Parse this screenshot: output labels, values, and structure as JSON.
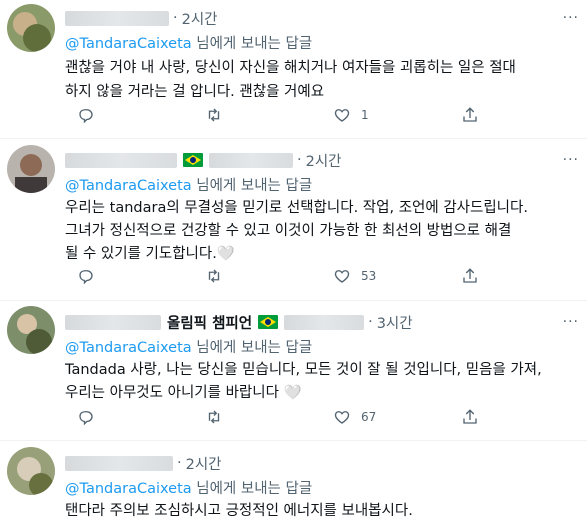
{
  "tweets": [
    {
      "time": "2시간",
      "mention": "@TandaraCaixeta",
      "reply_suffix": " 님에게 보내는 답글",
      "lines": [
        "괜찮을 거야 내 사랑, 당신이 자신을 해치거나 여자들을 괴롭히는 일은 절대",
        "하지 않을 거라는 걸 압니다. 괜찮을 거예요"
      ],
      "like_count": "1"
    },
    {
      "time": "2시간",
      "mention": "@TandaraCaixeta",
      "reply_suffix": " 님에게 보내는 답글",
      "lines": [
        "우리는 tandara의 무결성을 믿기로 선택합니다. 작업, 조언에 감사드립니다.",
        "그녀가 정신적으로 건강할 수 있고 이것이 가능한 한 최선의 방법으로 해결",
        "될 수 있기를 기도합니다.🤍"
      ],
      "like_count": "53"
    },
    {
      "name": "올림픽 챔피언",
      "time": "3시간",
      "mention": "@TandaraCaixeta",
      "reply_suffix": " 님에게 보내는 답글",
      "lines": [
        "Tandada 사랑, 나는 당신을 믿습니다, 모든 것이 잘 될 것입니다, 믿음을 가져,",
        "우리는 아무것도 아니기를 바랍니다 🤍"
      ],
      "like_count": "67"
    },
    {
      "time": "2시간",
      "mention": "@TandaraCaixeta",
      "reply_suffix": " 님에게 보내는 답글",
      "lines": [
        "탠다라 주의보 조심하시고 긍정적인 에너지를 보내봅시다."
      ]
    }
  ],
  "more_glyph": "···",
  "colors": {
    "accent": "#1d9bf0",
    "muted": "#536471",
    "text": "#0f1419"
  }
}
